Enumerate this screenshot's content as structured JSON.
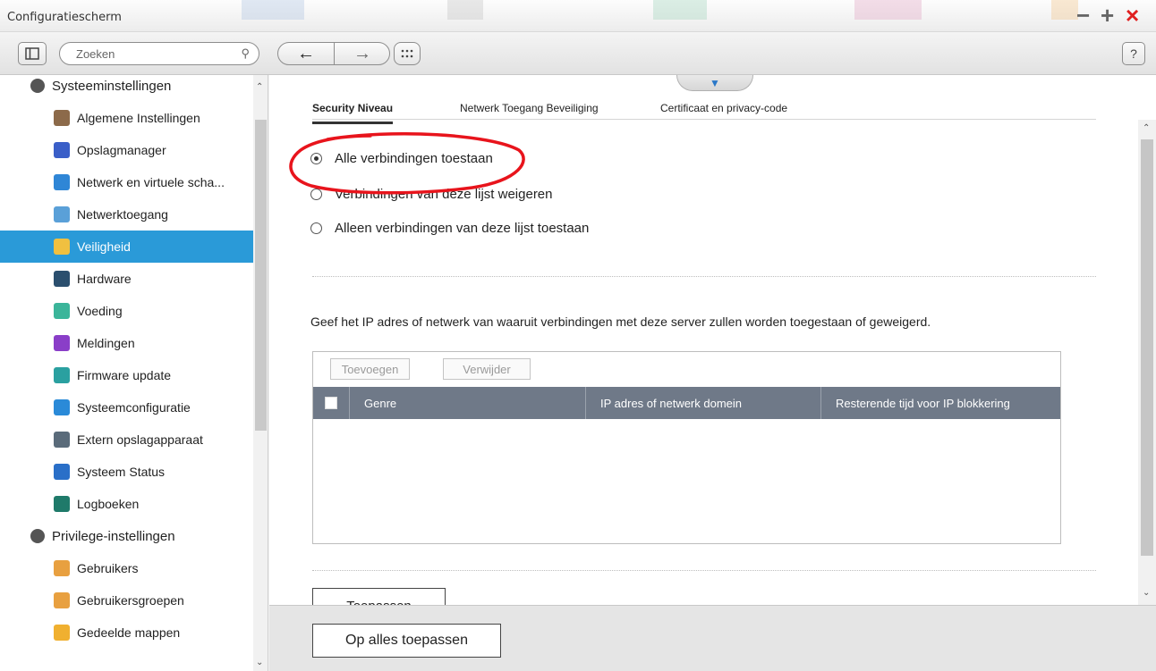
{
  "window": {
    "title": "Configuratiescherm"
  },
  "toolbar": {
    "search_placeholder": "Zoeken",
    "help_label": "?"
  },
  "sidebar": {
    "items": [
      {
        "label": "Systeeminstellingen",
        "group": true,
        "icon": "gear-icon",
        "color": "#555555"
      },
      {
        "label": "Algemene Instellingen",
        "icon": "settings-doc-icon",
        "color": "#8c6a4a"
      },
      {
        "label": "Opslagmanager",
        "icon": "storage-icon",
        "color": "#3a5fc8"
      },
      {
        "label": "Netwerk en virtuele scha...",
        "icon": "network-switch-icon",
        "color": "#2f86d6"
      },
      {
        "label": "Netwerktoegang",
        "icon": "network-access-icon",
        "color": "#5aa0d8"
      },
      {
        "label": "Veiligheid",
        "icon": "lock-icon",
        "color": "#f0c040",
        "active": true
      },
      {
        "label": "Hardware",
        "icon": "hardware-icon",
        "color": "#2b4f6e"
      },
      {
        "label": "Voeding",
        "icon": "power-bulb-icon",
        "color": "#3bb59a"
      },
      {
        "label": "Meldingen",
        "icon": "notification-icon",
        "color": "#8a3ec8"
      },
      {
        "label": "Firmware update",
        "icon": "firmware-icon",
        "color": "#2aa0a0"
      },
      {
        "label": "Systeemconfiguratie",
        "icon": "system-config-icon",
        "color": "#2a8ad8"
      },
      {
        "label": "Extern opslagapparaat",
        "icon": "external-storage-icon",
        "color": "#5a6b7a"
      },
      {
        "label": "Systeem Status",
        "icon": "monitor-icon",
        "color": "#2a6fc8"
      },
      {
        "label": "Logboeken",
        "icon": "log-icon",
        "color": "#1f7a6a"
      },
      {
        "label": "Privilege-instellingen",
        "group": true,
        "icon": "user-group-icon",
        "color": "#555555"
      },
      {
        "label": "Gebruikers",
        "icon": "user-icon",
        "color": "#e8a040"
      },
      {
        "label": "Gebruikersgroepen",
        "icon": "users-icon",
        "color": "#e8a040"
      },
      {
        "label": "Gedeelde mappen",
        "icon": "shared-folder-icon",
        "color": "#f0b030"
      }
    ]
  },
  "tabs": [
    {
      "label": "Security Niveau",
      "active": true
    },
    {
      "label": "Netwerk Toegang Beveiliging"
    },
    {
      "label": "Certificaat en privacy-code"
    }
  ],
  "security": {
    "options": [
      {
        "label": "Alle verbindingen toestaan",
        "selected": true
      },
      {
        "label": "Verbindingen van deze lijst weigeren"
      },
      {
        "label": "Alleen verbindingen van deze lijst toestaan"
      }
    ],
    "description": "Geef het IP adres of netwerk van waaruit verbindingen met deze server zullen worden toegestaan of geweigerd.",
    "add_label": "Toevoegen",
    "remove_label": "Verwijder",
    "columns": [
      "Genre",
      "IP adres of netwerk domein",
      "Resterende tijd voor IP blokkering"
    ],
    "apply_label": "Toepassen",
    "apply_all_label": "Op alles toepassen"
  },
  "colors": {
    "accent": "#2a9ad8",
    "table_header": "#6f7988",
    "annotation": "#e8141c",
    "close": "#e02020"
  }
}
